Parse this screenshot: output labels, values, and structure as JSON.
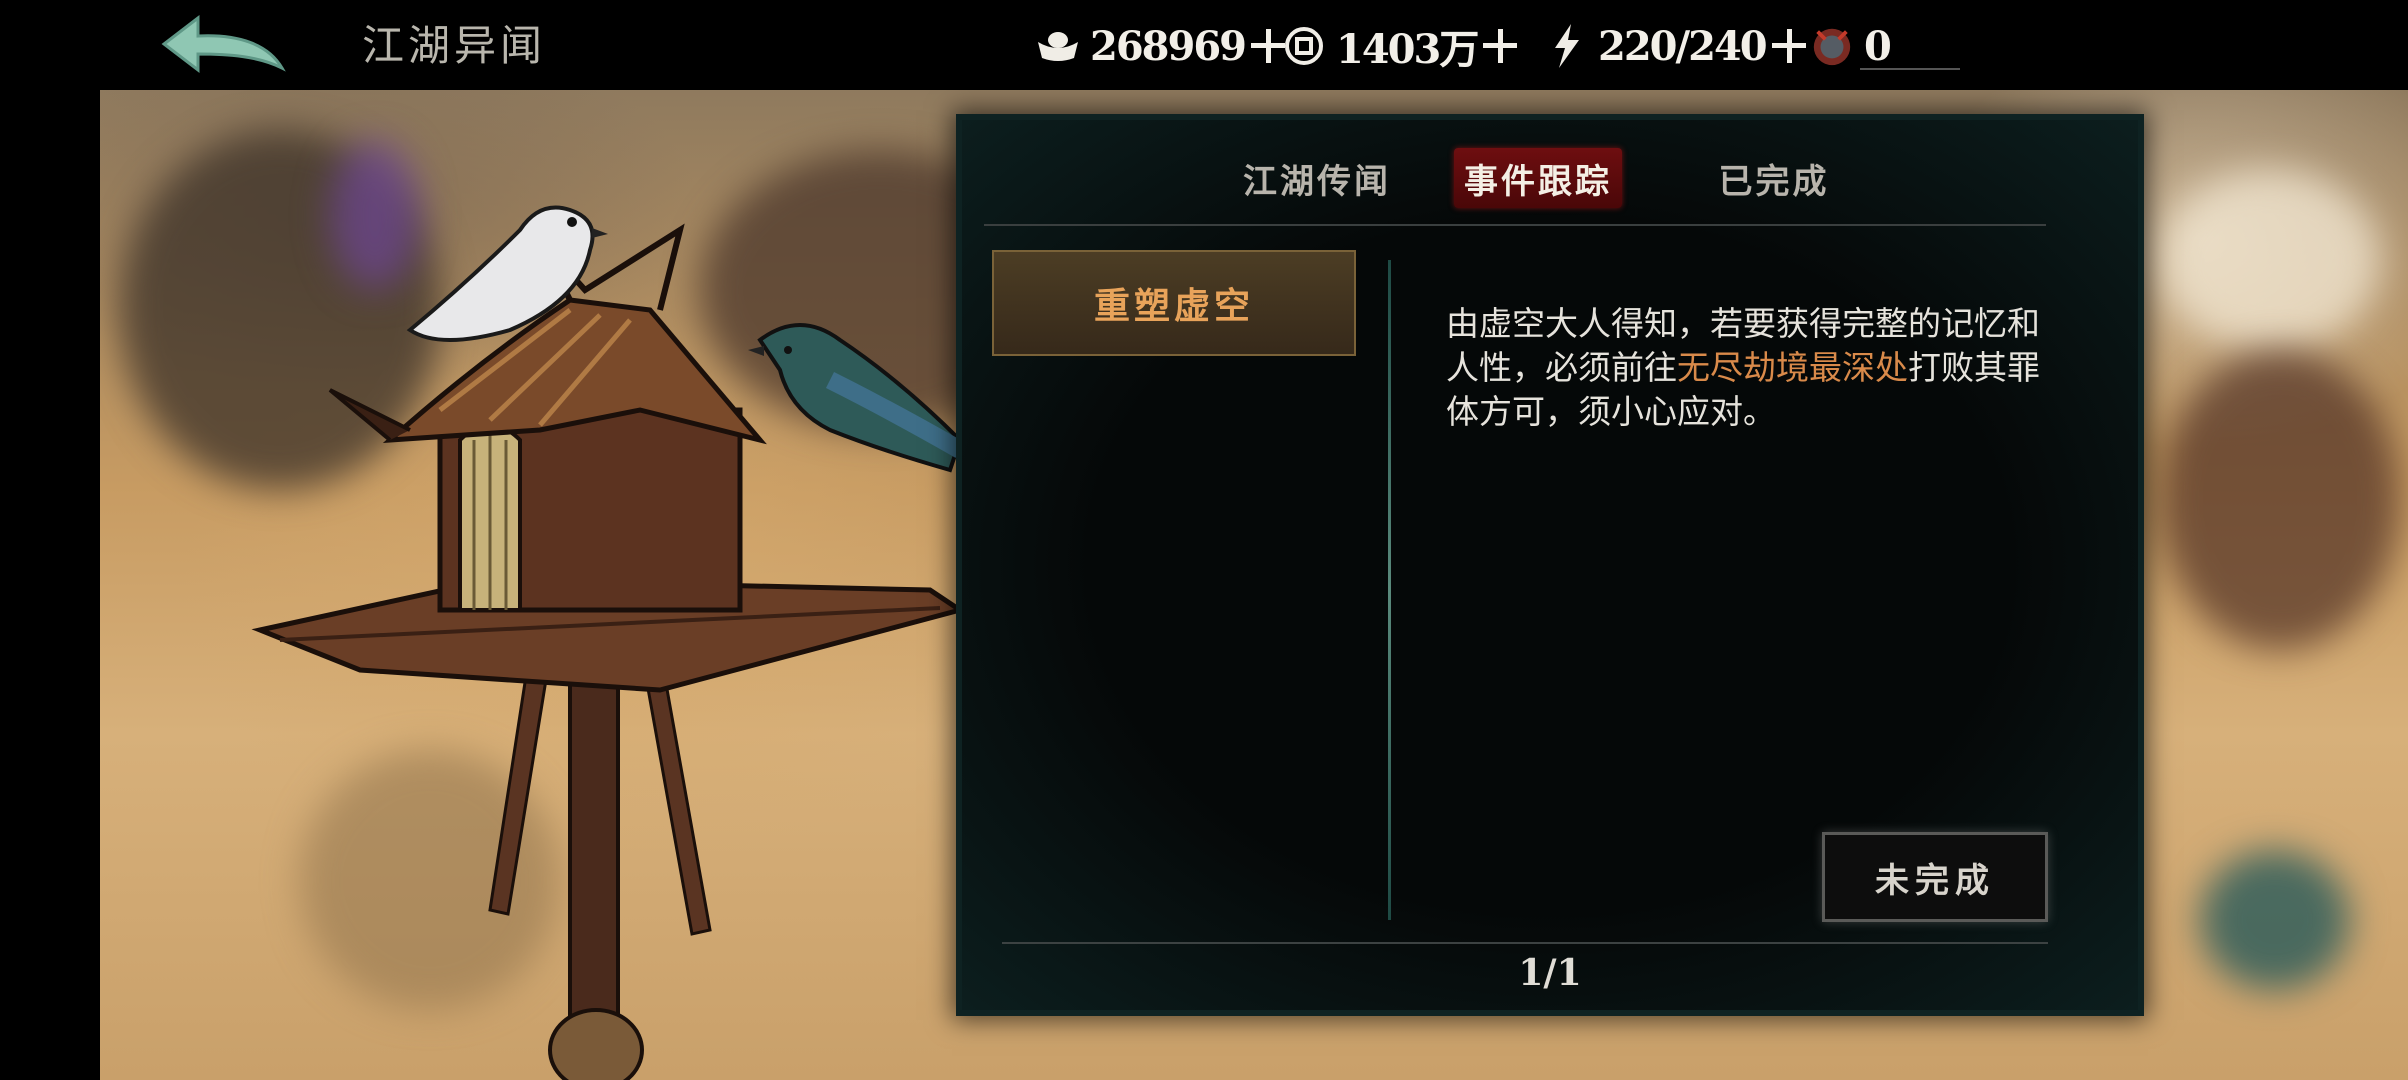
{
  "header": {
    "title": "江湖异闻",
    "resources": [
      {
        "icon": "silver-ingot-icon",
        "value": "268969"
      },
      {
        "icon": "copper-coin-icon",
        "value": "1403万"
      },
      {
        "icon": "lightning-energy-icon",
        "value": "220/240"
      },
      {
        "icon": "demon-mask-icon",
        "value": "0"
      }
    ]
  },
  "panel": {
    "tabs": [
      {
        "label": "江湖传闻",
        "active": false
      },
      {
        "label": "事件跟踪",
        "active": true
      },
      {
        "label": "已完成",
        "active": false
      }
    ],
    "quest_list": [
      {
        "label": "重塑虚空"
      }
    ],
    "description": {
      "text_before": "由虚空大人得知，若要获得完整的记忆和人性，必须前往",
      "highlight": "无尽劫境最深处",
      "text_after": "打败其罪体方可，须小心应对。",
      "highlight_color": "#d98a4a"
    },
    "status_button": "未完成",
    "pagination": "1/1"
  }
}
